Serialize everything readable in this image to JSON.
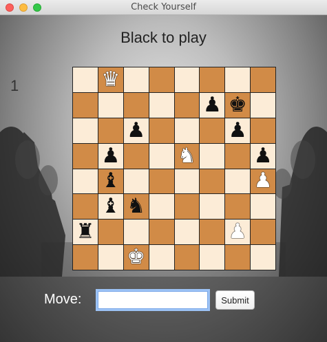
{
  "window": {
    "title": "Check Yourself"
  },
  "heading": "Black to play",
  "counter": "1",
  "board": [
    [
      "",
      "wQ",
      "",
      "",
      "",
      "",
      "",
      ""
    ],
    [
      "",
      "",
      "",
      "",
      "",
      "bP",
      "bK",
      ""
    ],
    [
      "",
      "",
      "bP",
      "",
      "",
      "",
      "bP",
      ""
    ],
    [
      "",
      "bP",
      "",
      "",
      "wN",
      "",
      "",
      "bP"
    ],
    [
      "",
      "bB",
      "",
      "",
      "",
      "",
      "",
      "wP"
    ],
    [
      "",
      "bB",
      "bN",
      "",
      "",
      "",
      "",
      ""
    ],
    [
      "bR",
      "",
      "",
      "",
      "",
      "",
      "wP",
      ""
    ],
    [
      "",
      "",
      "wK",
      "",
      "",
      "",
      "",
      ""
    ]
  ],
  "pieces": {
    "wK": {
      "glyph": "♚",
      "side": "w",
      "name": "white-king"
    },
    "wQ": {
      "glyph": "♛",
      "side": "w",
      "name": "white-queen"
    },
    "wR": {
      "glyph": "♜",
      "side": "w",
      "name": "white-rook"
    },
    "wB": {
      "glyph": "♝",
      "side": "w",
      "name": "white-bishop"
    },
    "wN": {
      "glyph": "♞",
      "side": "w",
      "name": "white-knight"
    },
    "wP": {
      "glyph": "♟",
      "side": "w",
      "name": "white-pawn"
    },
    "bK": {
      "glyph": "♚",
      "side": "b",
      "name": "black-king"
    },
    "bQ": {
      "glyph": "♛",
      "side": "b",
      "name": "black-queen"
    },
    "bR": {
      "glyph": "♜",
      "side": "b",
      "name": "black-rook"
    },
    "bB": {
      "glyph": "♝",
      "side": "b",
      "name": "black-bishop"
    },
    "bN": {
      "glyph": "♞",
      "side": "b",
      "name": "black-knight"
    },
    "bP": {
      "glyph": "♟",
      "side": "b",
      "name": "black-pawn"
    }
  },
  "colors": {
    "light_square": "#fcecd7",
    "dark_square": "#d18b47"
  },
  "move_form": {
    "label": "Move:",
    "input_value": "",
    "submit_label": "Submit"
  }
}
